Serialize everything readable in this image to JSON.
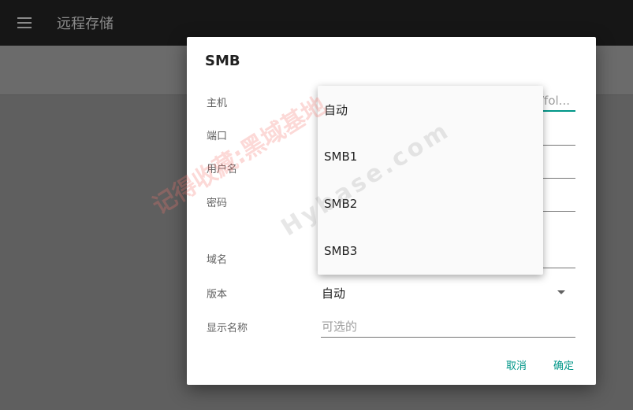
{
  "appbar": {
    "title": "远程存储",
    "menu_icon": "hamburger-menu-icon"
  },
  "dialog": {
    "title": "SMB",
    "fields": {
      "host_label": "主机",
      "host_value_tail": "/fol...",
      "port_label": "端口",
      "username_label": "用户名",
      "password_label": "密码",
      "domain_label": "域名",
      "version_label": "版本",
      "version_value": "自动",
      "display_name_label": "显示名称",
      "display_name_placeholder": "可选的"
    },
    "buttons": {
      "cancel": "取消",
      "ok": "确定"
    }
  },
  "version_menu": {
    "options": [
      "自动",
      "SMB1",
      "SMB2",
      "SMB3"
    ]
  },
  "watermark": {
    "text": "记得收藏:黑域基地",
    "sub": "Hybase.com"
  },
  "colors": {
    "accent": "#009688",
    "appbar": "#161616",
    "scrim": "#5f5f5f"
  }
}
